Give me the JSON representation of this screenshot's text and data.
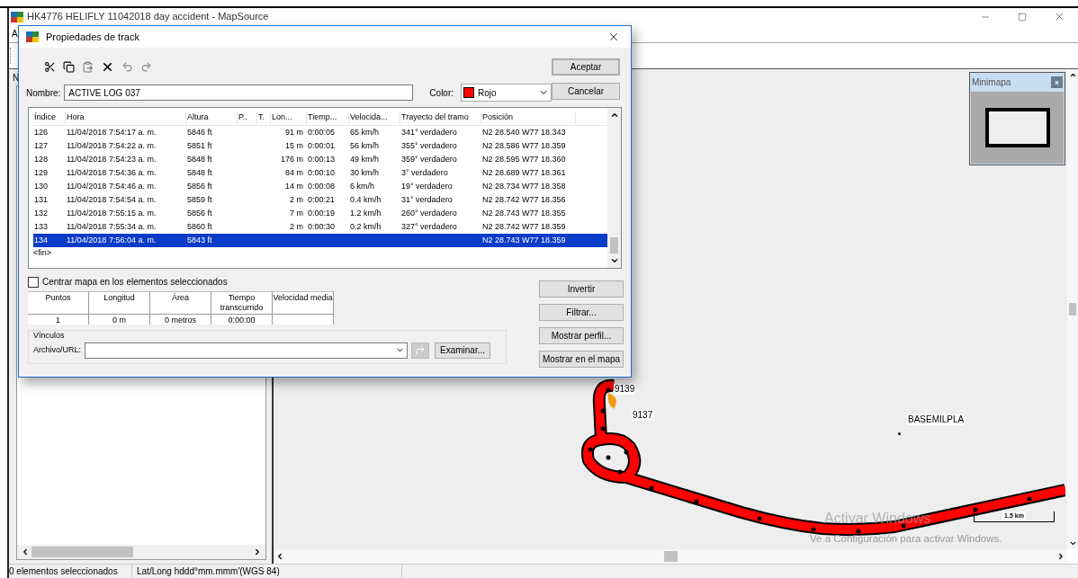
{
  "window": {
    "title": "HK4776 HELIFLY 11042018 day accident - MapSource",
    "menu_letter": "A",
    "panel_letter": "N"
  },
  "dialog": {
    "title": "Propiedades de track",
    "name_label": "Nombre:",
    "name_value": "ACTIVE LOG 037",
    "color_label": "Color:",
    "color_name": "Rojo",
    "color": "#ff0000",
    "buttons": [
      "Aceptar",
      "Cancelar"
    ],
    "table": {
      "columns": [
        "Índice",
        "Hora",
        "Altura",
        "P..",
        "T.",
        "Lon...",
        "Tiemp...",
        "Velocida...",
        "Trayecto del tramo",
        "Posición"
      ],
      "rows": [
        {
          "index": "126",
          "time": "11/04/2018 7:54:17 a. m.",
          "altitude": "5846 ft",
          "length": "91 m",
          "duration": "0:00:05",
          "speed": "65 km/h",
          "course": "341° verdadero",
          "position": "N2 28.540 W77 18.343",
          "selected": false
        },
        {
          "index": "127",
          "time": "11/04/2018 7:54:22 a. m.",
          "altitude": "5851 ft",
          "length": "15 m",
          "duration": "0:00:01",
          "speed": "56 km/h",
          "course": "355° verdadero",
          "position": "N2 28.586 W77 18.359",
          "selected": false
        },
        {
          "index": "128",
          "time": "11/04/2018 7:54:23 a. m.",
          "altitude": "5848 ft",
          "length": "176 m",
          "duration": "0:00:13",
          "speed": "49 km/h",
          "course": "359° verdadero",
          "position": "N2 28.595 W77 18.360",
          "selected": false
        },
        {
          "index": "129",
          "time": "11/04/2018 7:54:36 a. m.",
          "altitude": "5848 ft",
          "length": "84 m",
          "duration": "0:00:10",
          "speed": "30 km/h",
          "course": "3° verdadero",
          "position": "N2 28.689 W77 18.361",
          "selected": false
        },
        {
          "index": "130",
          "time": "11/04/2018 7:54:46 a. m.",
          "altitude": "5856 ft",
          "length": "14 m",
          "duration": "0:00:08",
          "speed": "6 km/h",
          "course": "19° verdadero",
          "position": "N2 28.734 W77 18.358",
          "selected": false
        },
        {
          "index": "131",
          "time": "11/04/2018 7:54:54 a. m.",
          "altitude": "5859 ft",
          "length": "2 m",
          "duration": "0:00:21",
          "speed": "0.4 km/h",
          "course": "31° verdadero",
          "position": "N2 28.742 W77 18.356",
          "selected": false
        },
        {
          "index": "132",
          "time": "11/04/2018 7:55:15 a. m.",
          "altitude": "5856 ft",
          "length": "7 m",
          "duration": "0:00:19",
          "speed": "1.2 km/h",
          "course": "260° verdadero",
          "position": "N2 28.743 W77 18.355",
          "selected": false
        },
        {
          "index": "133",
          "time": "11/04/2018 7:55:34 a. m.",
          "altitude": "5860 ft",
          "length": "2 m",
          "duration": "0:00:30",
          "speed": "0.2 km/h",
          "course": "327° verdadero",
          "position": "N2 28.742 W77 18.359",
          "selected": false
        },
        {
          "index": "134",
          "time": "11/04/2018 7:56:04 a. m.",
          "altitude": "5843 ft",
          "position": "N2 28.743 W77 18.359",
          "selected": true
        }
      ],
      "end_marker": "<fin>"
    },
    "center_map": {
      "label": "Centrar mapa en los elementos seleccionados",
      "checked": false
    },
    "stats": [
      {
        "header": "Puntos",
        "value": "1"
      },
      {
        "header": "Longitud",
        "value": "0 m"
      },
      {
        "header": "Área",
        "value": "0 metros"
      },
      {
        "header": "Tiempo transcurrido",
        "value": "0:00:00"
      },
      {
        "header": "Velocidad media"
      }
    ],
    "links": {
      "group": "Vínculos",
      "label": "Archivo/URL:",
      "browse": "Examinar..."
    },
    "side_buttons": [
      "Invertir",
      "Filtrar...",
      "Mostrar perfil...",
      "Mostrar en el mapa"
    ]
  },
  "minimap": {
    "title": "Minimapa",
    "close": "x"
  },
  "map": {
    "labels": [
      "9139",
      "9137",
      "BASEMILPLA"
    ],
    "scale": "1.5 km"
  },
  "activation_notice": [
    "Activar Windows",
    "Ve a Configuración para activar Windows."
  ],
  "status_bar": [
    "0 elementos seleccionados",
    "Lat/Long hddd°mm.mmm'(WGS 84)"
  ]
}
